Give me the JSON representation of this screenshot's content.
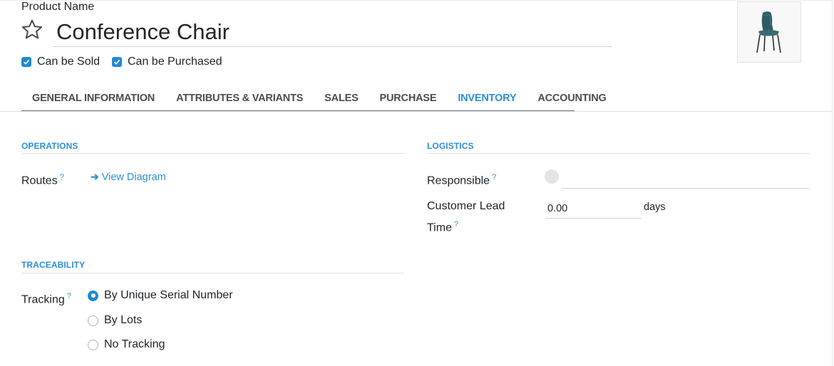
{
  "product": {
    "name_label": "Product Name",
    "name_value": "Conference Chair",
    "can_be_sold_label": "Can be Sold",
    "can_be_sold": true,
    "can_be_purchased_label": "Can be Purchased",
    "can_be_purchased": true
  },
  "tabs": [
    {
      "label": "GENERAL INFORMATION",
      "active": false
    },
    {
      "label": "ATTRIBUTES & VARIANTS",
      "active": false
    },
    {
      "label": "SALES",
      "active": false
    },
    {
      "label": "PURCHASE",
      "active": false
    },
    {
      "label": "INVENTORY",
      "active": true
    },
    {
      "label": "ACCOUNTING",
      "active": false
    }
  ],
  "operations": {
    "title": "OPERATIONS",
    "routes_label": "Routes",
    "help_mark": "?",
    "view_diagram": "View Diagram"
  },
  "logistics": {
    "title": "LOGISTICS",
    "responsible_label": "Responsible",
    "responsible_value": "",
    "lead_time_label_line1": "Customer Lead",
    "lead_time_label_line2": "Time",
    "lead_time_value": "0.00",
    "lead_time_unit": "days"
  },
  "traceability": {
    "title": "TRACEABILITY",
    "tracking_label": "Tracking",
    "options": [
      {
        "label": "By Unique Serial Number",
        "checked": true
      },
      {
        "label": "By Lots",
        "checked": false
      },
      {
        "label": "No Tracking",
        "checked": false
      }
    ]
  },
  "colors": {
    "accent": "#2d8fd4",
    "checkbox": "#1f8ad6",
    "text": "#212529"
  },
  "icons": {
    "favorite": "star-outline-icon",
    "image": "chair-photo",
    "arrow": "arrow-right-icon"
  }
}
